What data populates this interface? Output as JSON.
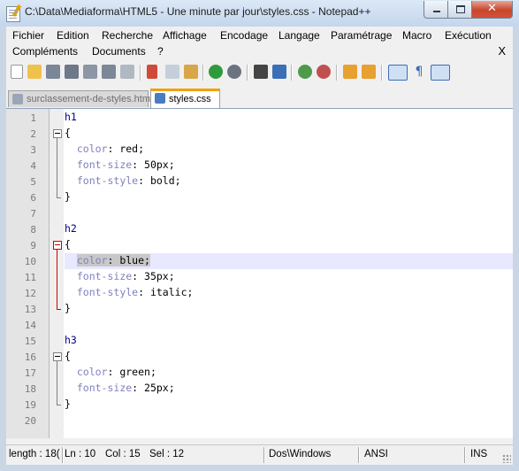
{
  "window": {
    "title": "C:\\Data\\Mediaforma\\HTML5 - Une minute par jour\\styles.css - Notepad++"
  },
  "menu": {
    "row1": [
      {
        "label": "Fichier",
        "name": "menu-fichier"
      },
      {
        "label": "Edition",
        "name": "menu-edition"
      },
      {
        "label": "Recherche",
        "name": "menu-recherche"
      },
      {
        "label": "Affichage",
        "name": "menu-affichage"
      },
      {
        "label": "Encodage",
        "name": "menu-encodage"
      },
      {
        "label": "Langage",
        "name": "menu-langage"
      },
      {
        "label": "Paramétrage",
        "name": "menu-parametrage"
      },
      {
        "label": "Macro",
        "name": "menu-macro"
      },
      {
        "label": "Exécution",
        "name": "menu-execution"
      }
    ],
    "row2": [
      {
        "label": "Compléments",
        "name": "menu-complements"
      },
      {
        "label": "Documents",
        "name": "menu-documents"
      },
      {
        "label": "?",
        "name": "menu-help"
      }
    ],
    "close_label": "X"
  },
  "toolbar": {
    "icons": [
      "new-file-icon",
      "open-file-icon",
      "save-icon",
      "save-all-icon",
      "close-icon",
      "close-all-icon",
      "print-icon",
      "cut-icon",
      "copy-icon",
      "paste-icon",
      "undo-icon",
      "redo-icon",
      "find-icon",
      "replace-icon",
      "zoom-in-icon",
      "zoom-out-icon",
      "sync-vertical-icon",
      "sync-horizontal-icon",
      "word-wrap-icon",
      "show-all-chars-icon",
      "indent-guide-icon"
    ]
  },
  "tabs": [
    {
      "label": "surclassement-de-styles.htm",
      "active": false
    },
    {
      "label": "styles.css",
      "active": true
    }
  ],
  "editor": {
    "lines": [
      {
        "n": "1",
        "sel": "h1",
        "prop": "",
        "val": ""
      },
      {
        "n": "2",
        "sel": "{",
        "prop": "",
        "val": ""
      },
      {
        "n": "3",
        "sel": "  ",
        "prop": "color",
        "val": ": red;"
      },
      {
        "n": "4",
        "sel": "  ",
        "prop": "font-size",
        "val": ": 50px;"
      },
      {
        "n": "5",
        "sel": "  ",
        "prop": "font-style",
        "val": ": bold;"
      },
      {
        "n": "6",
        "sel": "}",
        "prop": "",
        "val": ""
      },
      {
        "n": "7",
        "sel": "",
        "prop": "",
        "val": ""
      },
      {
        "n": "8",
        "sel": "h2",
        "prop": "",
        "val": ""
      },
      {
        "n": "9",
        "sel": "{",
        "prop": "",
        "val": ""
      },
      {
        "n": "10",
        "sel": "  ",
        "prop": "color",
        "val": ": blue;"
      },
      {
        "n": "11",
        "sel": "  ",
        "prop": "font-size",
        "val": ": 35px;"
      },
      {
        "n": "12",
        "sel": "  ",
        "prop": "font-style",
        "val": ": italic;"
      },
      {
        "n": "13",
        "sel": "}",
        "prop": "",
        "val": ""
      },
      {
        "n": "14",
        "sel": "",
        "prop": "",
        "val": ""
      },
      {
        "n": "15",
        "sel": "h3",
        "prop": "",
        "val": ""
      },
      {
        "n": "16",
        "sel": "{",
        "prop": "",
        "val": ""
      },
      {
        "n": "17",
        "sel": "  ",
        "prop": "color",
        "val": ": green;"
      },
      {
        "n": "18",
        "sel": "  ",
        "prop": "font-size",
        "val": ": 25px;"
      },
      {
        "n": "19",
        "sel": "}",
        "prop": "",
        "val": ""
      },
      {
        "n": "20",
        "sel": "",
        "prop": "",
        "val": ""
      }
    ],
    "current_line": 10
  },
  "status": {
    "length": "length : 18(",
    "line": "Ln : 10",
    "col": "Col : 15",
    "sel": "Sel : 12",
    "eol": "Dos\\Windows",
    "encoding": "ANSI",
    "mode": "INS"
  },
  "colors": {
    "active_tab_accent": "#f2a10c",
    "selector": "#00008b",
    "property": "#8080c0",
    "current_line": "#e8e8ff",
    "fold_active": "#d00000"
  }
}
